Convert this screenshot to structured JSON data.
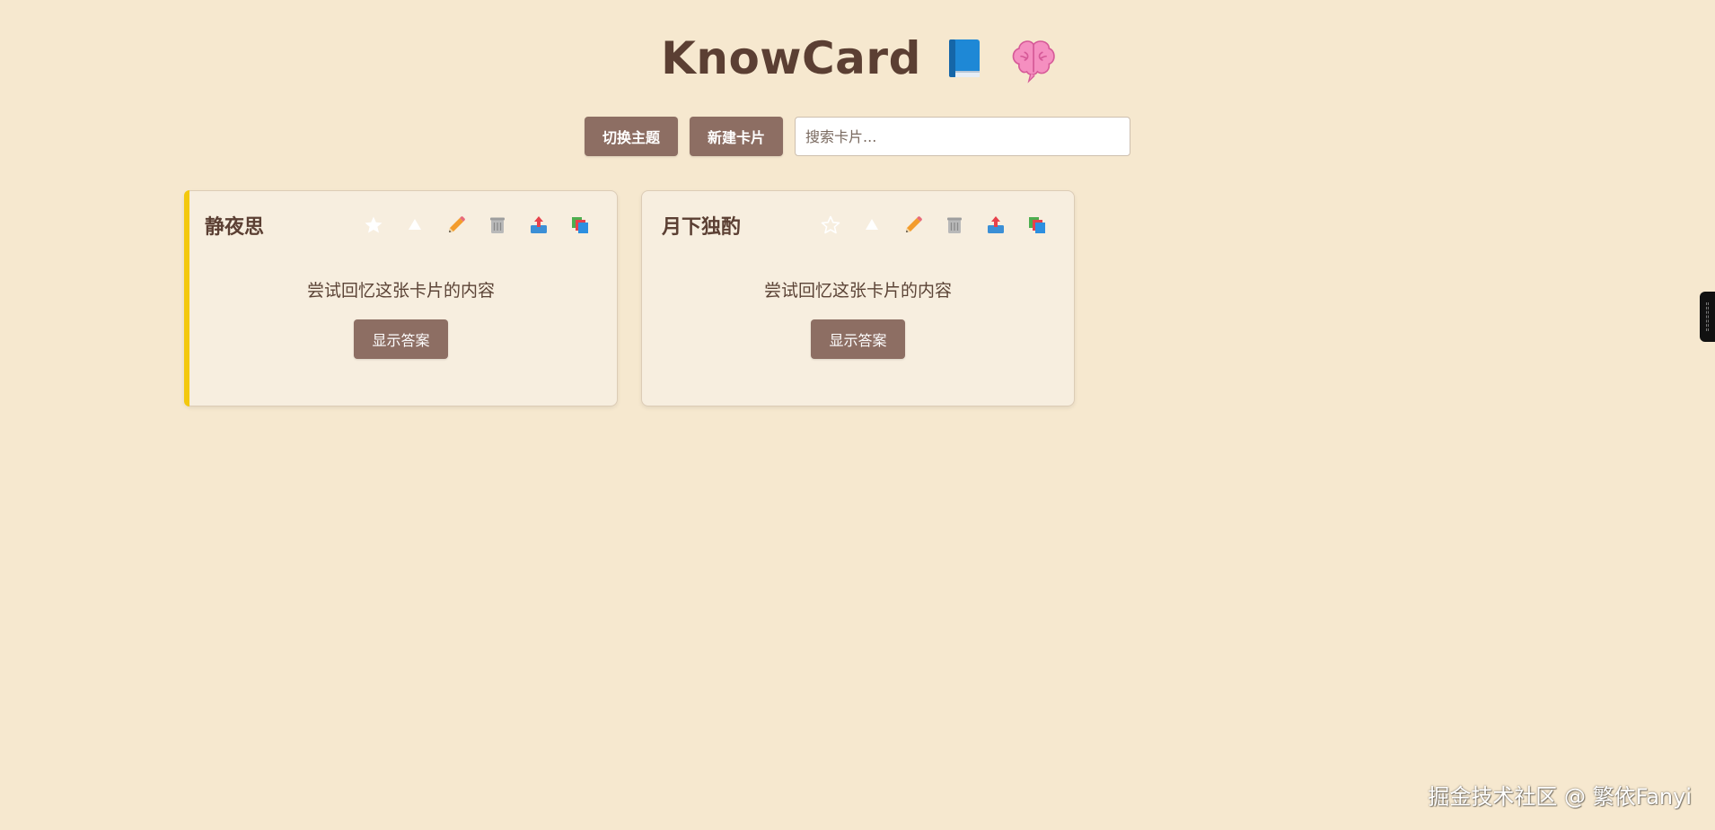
{
  "header": {
    "title": "KnowCard",
    "icons": [
      "book-icon",
      "brain-icon"
    ]
  },
  "toolbar": {
    "toggle_theme_label": "切换主题",
    "new_card_label": "新建卡片",
    "search_placeholder": "搜索卡片..."
  },
  "cards": [
    {
      "title": "静夜思",
      "starred": true,
      "prompt": "尝试回忆这张卡片的内容",
      "show_answer_label": "显示答案"
    },
    {
      "title": "月下独酌",
      "starred": false,
      "prompt": "尝试回忆这张卡片的内容",
      "show_answer_label": "显示答案"
    }
  ],
  "card_actions": [
    "star-icon",
    "up-arrow-icon",
    "pencil-icon",
    "trash-icon",
    "export-icon",
    "copy-icon"
  ],
  "colors": {
    "background": "#f6e8cf",
    "button": "#8d6e63",
    "star_accent": "#f3c80d",
    "text": "#5b3f33"
  },
  "watermark": "掘金技术社区 @ 繁依Fanyi"
}
